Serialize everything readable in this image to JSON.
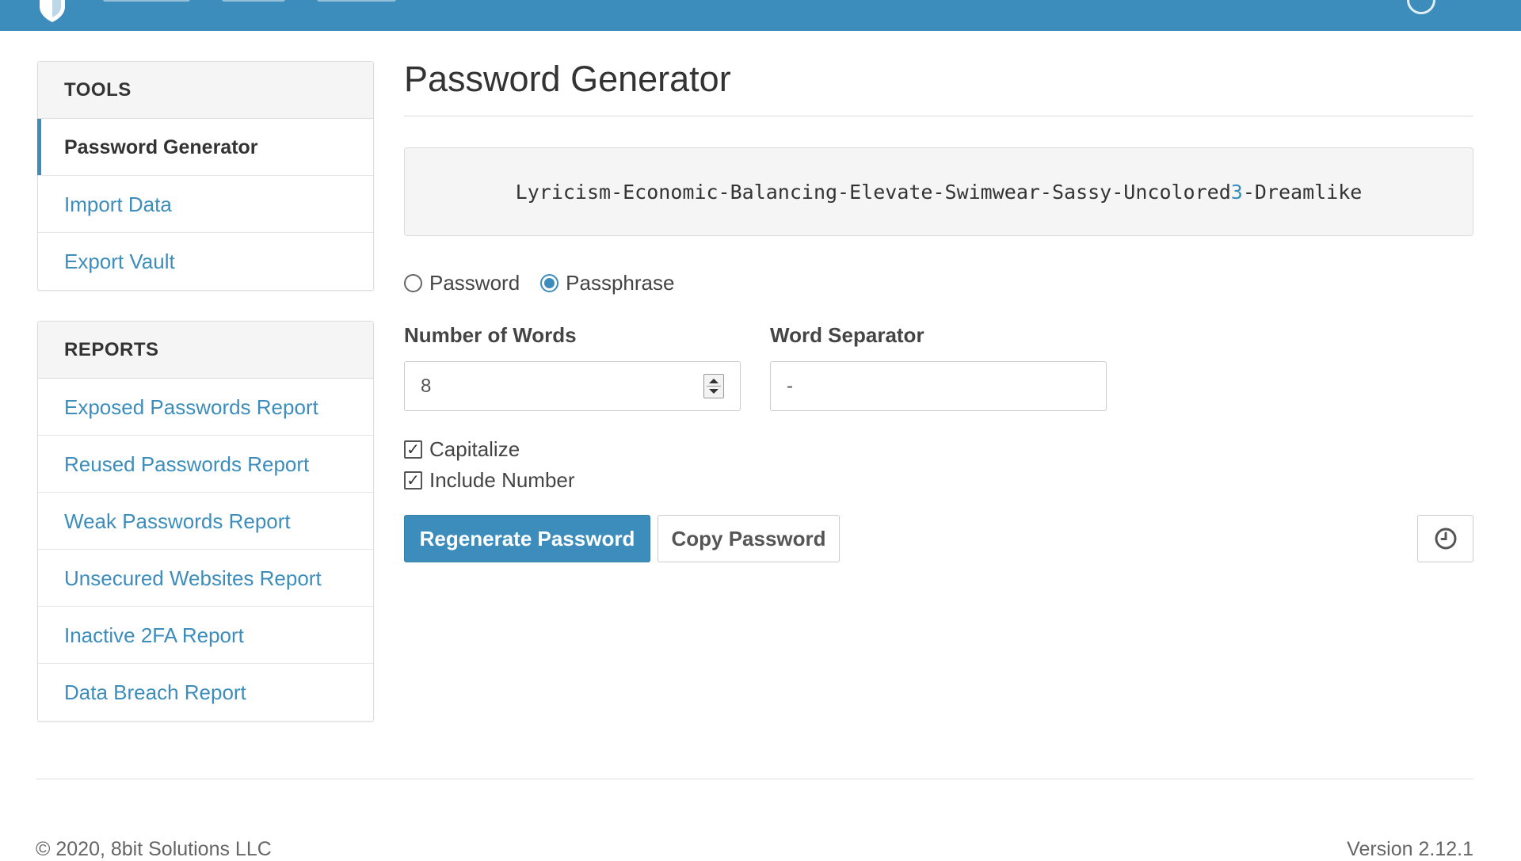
{
  "colors": {
    "brand": "#3c8dbc",
    "text": "#333333",
    "link": "#3c8dbc"
  },
  "topbar": {
    "logo_icon": "shield-icon",
    "account_icon": "account-circle-icon"
  },
  "sidebar": {
    "tools": {
      "heading": "TOOLS",
      "items": [
        {
          "label": "Password Generator",
          "active": true
        },
        {
          "label": "Import Data",
          "active": false
        },
        {
          "label": "Export Vault",
          "active": false
        }
      ]
    },
    "reports": {
      "heading": "REPORTS",
      "items": [
        {
          "label": "Exposed Passwords Report"
        },
        {
          "label": "Reused Passwords Report"
        },
        {
          "label": "Weak Passwords Report"
        },
        {
          "label": "Unsecured Websites Report"
        },
        {
          "label": "Inactive 2FA Report"
        },
        {
          "label": "Data Breach Report"
        }
      ]
    }
  },
  "main": {
    "title": "Password Generator",
    "generated": {
      "before_number": "Lyricism-Economic-Balancing-Elevate-Swimwear-Sassy-Uncolored",
      "number": "3",
      "after_number": "-Dreamlike"
    },
    "type_options": [
      {
        "label": "Password",
        "selected": false
      },
      {
        "label": "Passphrase",
        "selected": true
      }
    ],
    "num_words": {
      "label": "Number of Words",
      "value": "8"
    },
    "word_separator": {
      "label": "Word Separator",
      "value": "-"
    },
    "capitalize": {
      "label": "Capitalize",
      "checked": true
    },
    "include_number": {
      "label": "Include Number",
      "checked": true
    },
    "buttons": {
      "regenerate": "Regenerate Password",
      "copy": "Copy Password",
      "history_icon": "history-clock-icon"
    }
  },
  "footer": {
    "copyright": "© 2020, 8bit Solutions LLC",
    "version": "Version 2.12.1"
  }
}
